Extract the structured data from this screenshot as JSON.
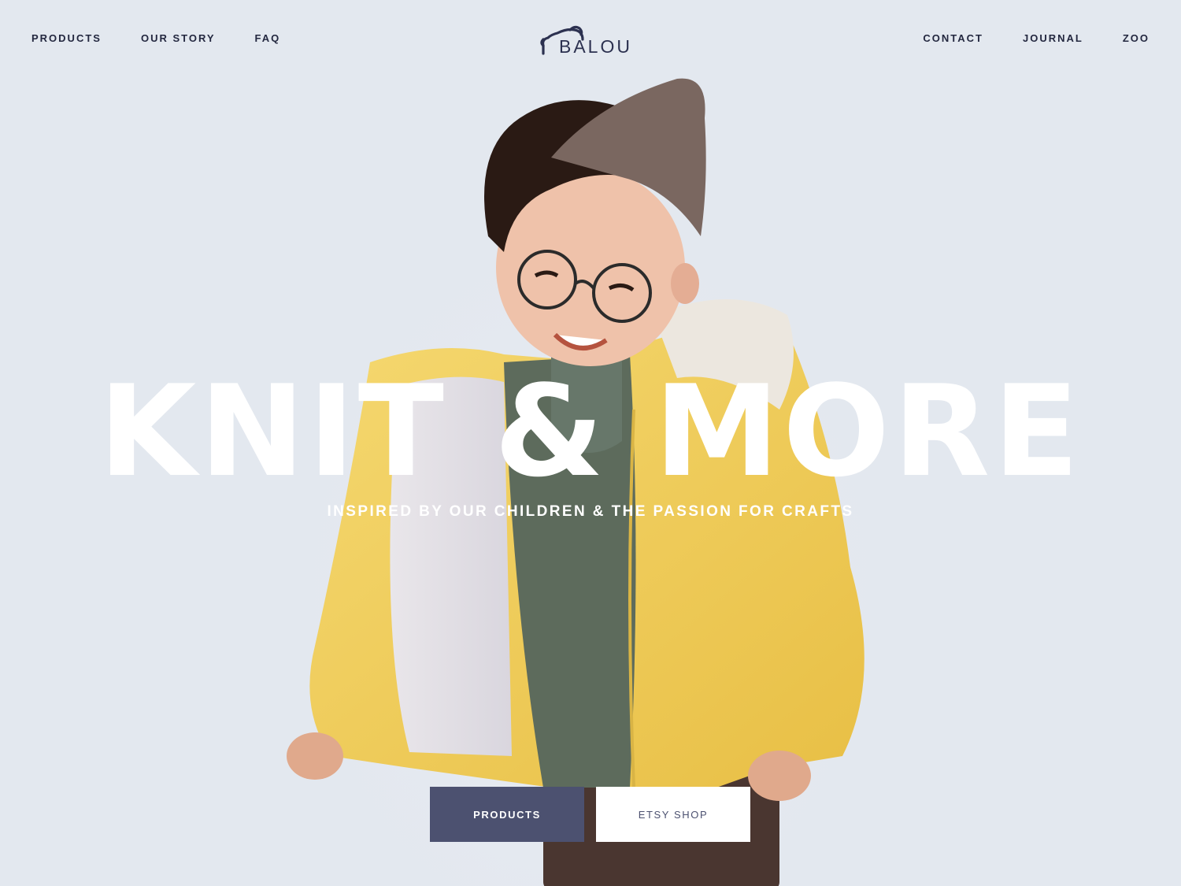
{
  "nav": {
    "left": [
      "PRODUCTS",
      "OUR STORY",
      "FAQ"
    ],
    "right": [
      "CONTACT",
      "JOURNAL",
      "ZOO"
    ]
  },
  "brand": {
    "name": "BALOU",
    "icon": "bear-ear-icon"
  },
  "hero": {
    "headline": "KNIT & MORE",
    "subheadline": "INSPIRED BY OUR CHILDREN & THE PASSION FOR CRAFTS",
    "image": "child-in-yellow-jacket-photo"
  },
  "cta": {
    "primary_label": "PRODUCTS",
    "secondary_label": "ETSY SHOP"
  },
  "colors": {
    "background": "#e3e8ef",
    "navy": "#23273f",
    "button_primary": "#4c5170",
    "button_secondary": "#ffffff",
    "jacket_yellow": "#f0cc55"
  }
}
